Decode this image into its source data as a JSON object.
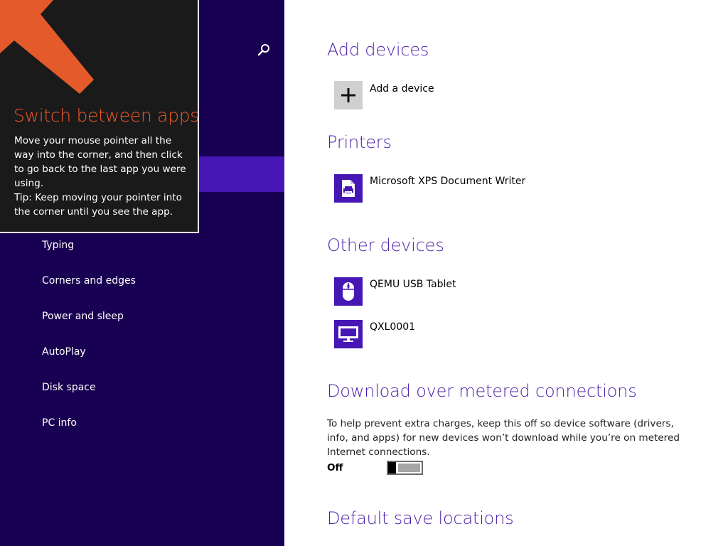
{
  "sidebar": {
    "items": [
      {
        "label": "Typing"
      },
      {
        "label": "Corners and edges"
      },
      {
        "label": "Power and sleep"
      },
      {
        "label": "AutoPlay"
      },
      {
        "label": "Disk space"
      },
      {
        "label": "PC info"
      }
    ],
    "search_icon": "search-icon"
  },
  "tooltip": {
    "title": "Switch between apps",
    "body_line1": "Move your mouse pointer all the way into the corner, and then click to go back to the last app you were using.",
    "body_line2": "Tip: Keep moving your pointer into the corner until you see the app.",
    "accent_color": "#f0572a"
  },
  "main": {
    "add_devices": {
      "heading": "Add devices",
      "add_label": "Add a device",
      "icon": "plus-icon"
    },
    "printers": {
      "heading": "Printers",
      "items": [
        {
          "label": "Microsoft XPS Document Writer",
          "icon": "printer-icon"
        }
      ]
    },
    "other_devices": {
      "heading": "Other devices",
      "items": [
        {
          "label": "QEMU USB Tablet",
          "icon": "mouse-icon"
        },
        {
          "label": "QXL0001",
          "icon": "monitor-icon"
        }
      ]
    },
    "metered": {
      "heading": "Download over metered connections",
      "description": "To help prevent extra charges, keep this off so device software (drivers, info, and apps) for new devices won’t download while you’re on metered Internet connections.",
      "toggle_state": "Off"
    },
    "save_locations": {
      "heading": "Default save locations"
    }
  },
  "colors": {
    "sidebar_bg": "#180052",
    "sidebar_selected": "#4617b4",
    "heading": "#4b1eac",
    "tile": "#4617b4"
  }
}
